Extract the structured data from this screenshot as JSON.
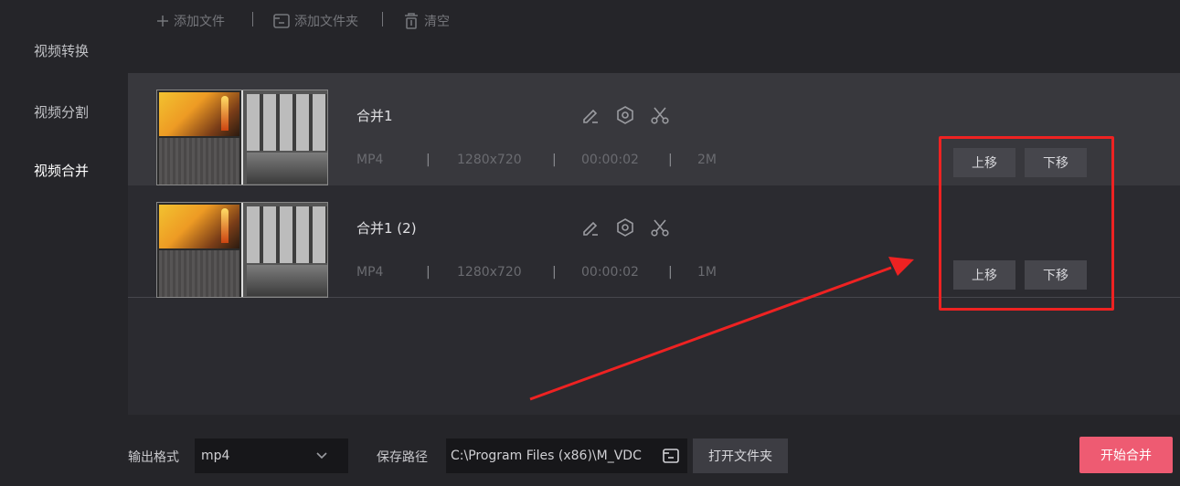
{
  "sidebar": {
    "items": [
      {
        "label": "视频转换",
        "active": false
      },
      {
        "label": "视频分割",
        "active": false
      },
      {
        "label": "视频合并",
        "active": true
      }
    ]
  },
  "toolbar": {
    "add_file": "添加文件",
    "add_folder": "添加文件夹",
    "clear": "清空"
  },
  "files": [
    {
      "name": "合并1",
      "format": "MP4",
      "resolution": "1280x720",
      "duration": "00:00:02",
      "size": "2M",
      "move_up": "上移",
      "move_down": "下移"
    },
    {
      "name": "合并1 (2)",
      "format": "MP4",
      "resolution": "1280x720",
      "duration": "00:00:02",
      "size": "1M",
      "move_up": "上移",
      "move_down": "下移"
    }
  ],
  "meta_separator": "|",
  "bottom": {
    "output_format_label": "输出格式",
    "output_format_value": "mp4",
    "save_path_label": "保存路径",
    "save_path_value": "C:\\Program Files (x86)\\M_VDC",
    "open_folder_label": "打开文件夹",
    "start_label": "开始合并"
  },
  "colors": {
    "accent": "#ee5b72",
    "annotation": "#ee2222",
    "background": "#252529",
    "list_background": "#2b2b30",
    "selected_row": "#38383d"
  },
  "icons": {
    "add_file": "plus-icon",
    "add_folder": "folder-icon",
    "clear": "trash-icon",
    "edit": "pencil-icon",
    "settings": "gear-hexagon-icon",
    "cut": "scissors-icon",
    "dropdown": "chevron-down-icon",
    "browse": "folder-icon"
  }
}
